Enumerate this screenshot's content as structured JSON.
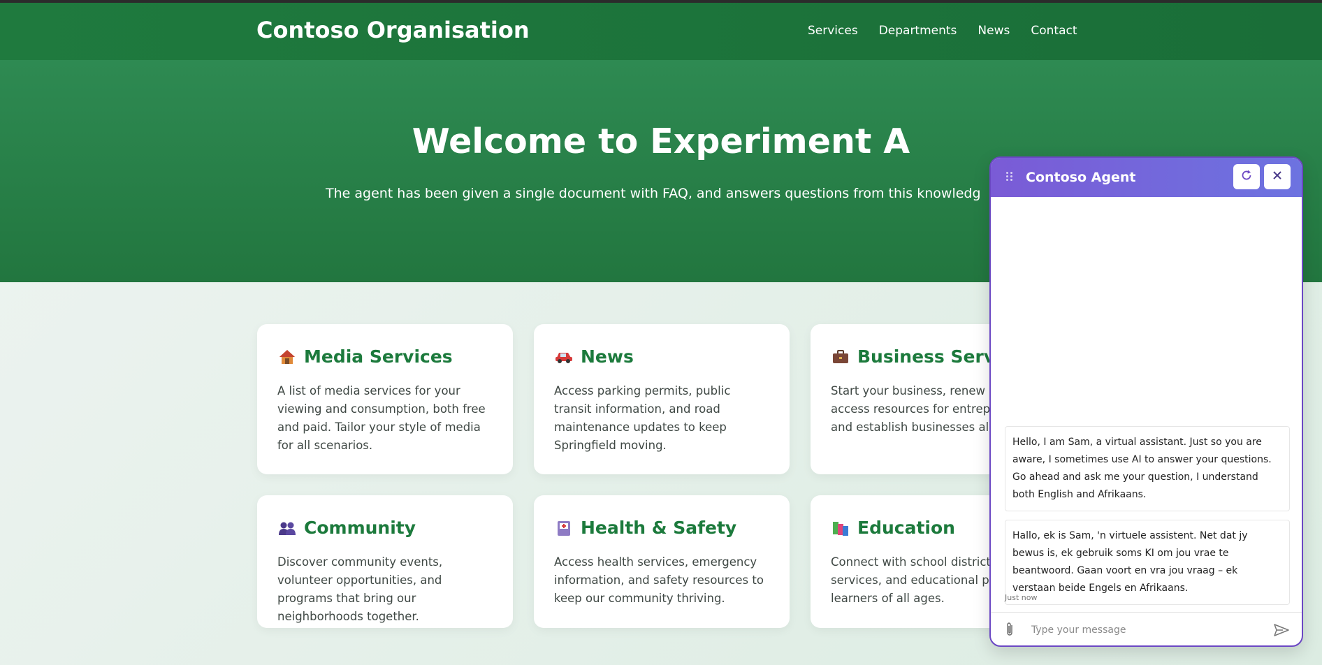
{
  "site": {
    "brand": "Contoso Organisation",
    "nav": [
      "Services",
      "Departments",
      "News",
      "Contact"
    ]
  },
  "hero": {
    "title": "Welcome to Experiment A",
    "subtitle": "The agent has been given a single document with FAQ, and answers questions from this knowledg"
  },
  "cards": [
    {
      "icon": "house-icon",
      "title": "Media Services",
      "desc": "A list of media services for your viewing and consumption, both free and paid. Tailor your style of media for all scenarios."
    },
    {
      "icon": "car-icon",
      "title": "News",
      "desc": "Access parking permits, public transit information, and road maintenance updates to keep Springfield moving."
    },
    {
      "icon": "briefcase-icon",
      "title": "Business Servic",
      "desc": "Start your business, renew li and access resources for entrepreneurs and establish businesses alike."
    },
    {
      "icon": "people-icon",
      "title": "Community",
      "desc": "Discover community events, volunteer opportunities, and programs that bring our neighborhoods together."
    },
    {
      "icon": "medical-icon",
      "title": "Health & Safety",
      "desc": "Access health services, emergency information, and safety resources to keep our community thriving."
    },
    {
      "icon": "books-icon",
      "title": "Education",
      "desc": "Connect with school districts services, and educational pro for learners of all ages."
    }
  ],
  "chat": {
    "title": "Contoso Agent",
    "messages": [
      "Hello, I am Sam, a virtual assistant. Just so you are aware, I sometimes use AI to answer your questions. Go ahead and ask me your question, I understand both English and Afrikaans.",
      "Hallo, ek is Sam, 'n virtuele assistent. Net dat jy bewus is, ek gebruik soms KI om jou vrae te beantwoord. Gaan voort en vra jou vraag – ek verstaan beide Engels en Afrikaans."
    ],
    "timestamp": "Just now",
    "placeholder": "Type your message",
    "accent": "#6b47c4"
  },
  "colors": {
    "header": "#1f7a3e",
    "card_title": "#1c7a3c"
  }
}
